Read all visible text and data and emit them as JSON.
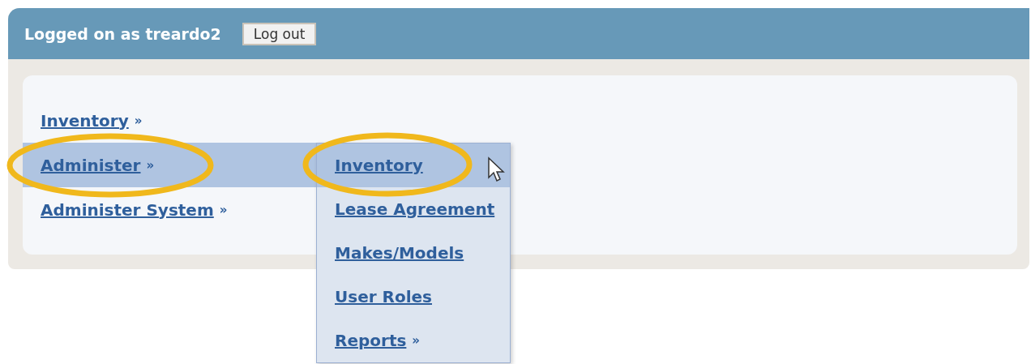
{
  "header": {
    "user_label": "Logged on as treardo2",
    "logout_button": "Log out"
  },
  "menu": [
    {
      "label": "Inventory",
      "arrow": "»",
      "selected": false,
      "circled": false
    },
    {
      "label": "Administer",
      "arrow": "»",
      "selected": true,
      "circled": true,
      "submenu": [
        {
          "label": "Inventory",
          "selected": true,
          "circled": true
        },
        {
          "label": "Lease Agreement",
          "selected": false,
          "circled": false
        },
        {
          "label": "Makes/Models",
          "selected": false,
          "circled": false
        },
        {
          "label": "User Roles",
          "selected": false,
          "circled": false
        },
        {
          "label": "Reports",
          "arrow": "»",
          "selected": false,
          "circled": false
        }
      ]
    },
    {
      "label": "Administer System",
      "arrow": "»",
      "selected": false,
      "circled": false
    }
  ]
}
